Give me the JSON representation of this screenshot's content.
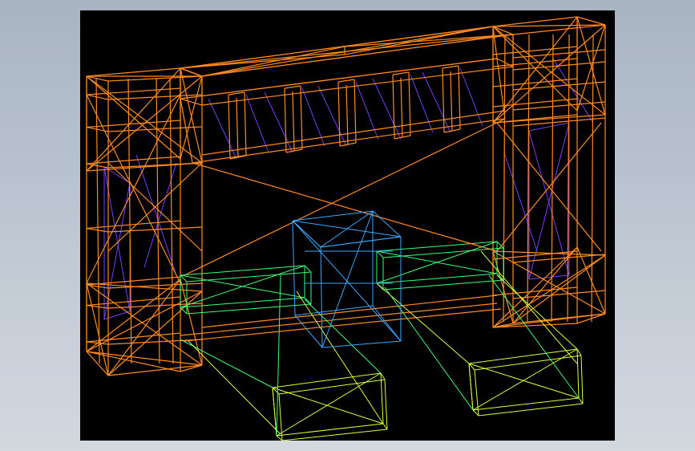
{
  "scene": {
    "background_color": "#000000",
    "app_background_gradient": [
      "#a9b4c3",
      "#d3d8df"
    ],
    "render_mode": "wireframe",
    "colors": {
      "frame_orange": "#ff8a1e",
      "truss_purple": "#7a3cff",
      "block_blue": "#3aa8ff",
      "rail_green": "#39ff7a",
      "feet_yellow": "#d8ff3a"
    },
    "parts": [
      "left-column-frame",
      "right-column-frame",
      "top-beam-truss",
      "central-cube",
      "left-rail",
      "right-rail",
      "left-foot",
      "right-foot"
    ]
  }
}
